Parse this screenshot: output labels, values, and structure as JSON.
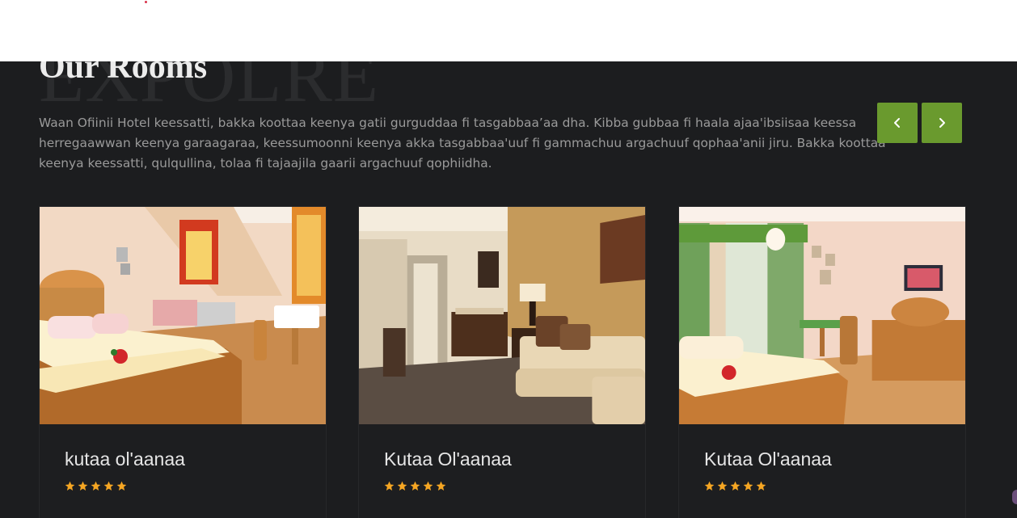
{
  "section": {
    "watermark": "EXPOLRE",
    "title": "Our Rooms",
    "description": "Waan Ofiinii Hotel keessatti, bakka koottaa keenya gatii gurguddaa fi tasgabbaa’aa dha. Kibba gubbaa fi haala ajaa'ibsiisaa keessa herregaawwan keenya garaagaraa, keessumoonni keenya akka tasgabbaa'uuf fi gammachuu argachuuf qophaa'anii jiru. Bakka koottaa keenya keessatti, qulqullina, tolaa fi tajaajila gaarii argachuuf qophiidha."
  },
  "carousel": {
    "prev_icon": "chevron-left-icon",
    "next_icon": "chevron-right-icon",
    "accent_color": "#6a9a2e"
  },
  "rooms": [
    {
      "name": "kutaa ol'aanaa",
      "rating": 5,
      "photo": "bedroom-photo-1"
    },
    {
      "name": "Kutaa Ol'aanaa",
      "rating": 5,
      "photo": "suite-living-room-photo"
    },
    {
      "name": "Kutaa Ol'aanaa",
      "rating": 5,
      "photo": "bedroom-photo-2"
    }
  ],
  "star_color": "#f5a623"
}
